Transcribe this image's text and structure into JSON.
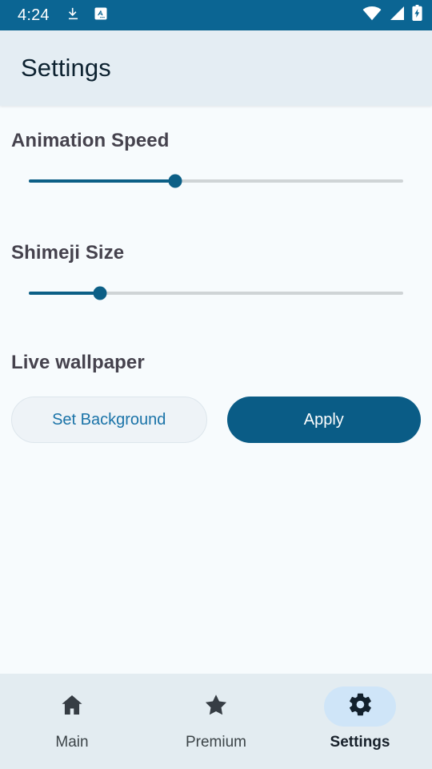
{
  "status_bar": {
    "time": "4:24",
    "left_icons": [
      "download-icon",
      "translate-icon"
    ],
    "right_icons": [
      "wifi-icon",
      "cellular-signal-icon",
      "battery-charging-icon"
    ],
    "background_color": "#0b6593"
  },
  "app_bar": {
    "title": "Settings",
    "background_color": "#e4edf3",
    "title_color": "#0d2230"
  },
  "settings": {
    "animation_speed": {
      "label": "Animation Speed",
      "value_percent": 39,
      "active_color": "#0c5f86",
      "inactive_color": "#cfd4d6"
    },
    "shimeji_size": {
      "label": "Shimeji Size",
      "value_percent": 19,
      "active_color": "#0c5f86",
      "inactive_color": "#cfd4d6"
    },
    "live_wallpaper": {
      "label": "Live wallpaper",
      "set_background_label": "Set Background",
      "set_background_color": "#1a73a8",
      "apply_label": "Apply",
      "apply_color": "#0a5c86"
    }
  },
  "bottom_nav": {
    "background_color": "#e3ecf1",
    "active_pill_color": "#cfe5f8",
    "items": [
      {
        "label": "Main",
        "icon": "home-icon",
        "active": false
      },
      {
        "label": "Premium",
        "icon": "star-icon",
        "active": false
      },
      {
        "label": "Settings",
        "icon": "gear-icon",
        "active": true
      }
    ]
  }
}
